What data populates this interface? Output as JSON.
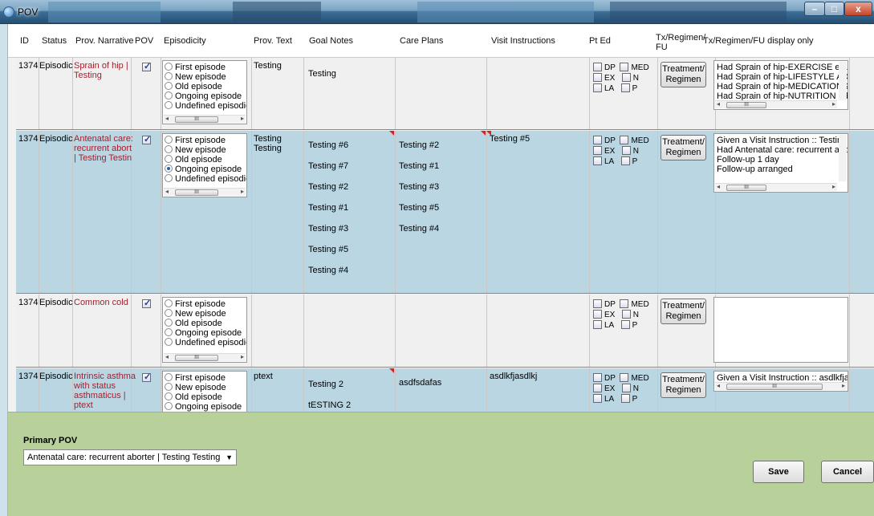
{
  "window": {
    "title": "POV",
    "min_label": "–",
    "max_label": "□",
    "close_label": "x"
  },
  "columns": {
    "id": "ID",
    "status": "Status",
    "narrative": "Prov. Narrative",
    "pov": "POV",
    "episodicity": "Episodicity",
    "prov_text": "Prov. Text",
    "goal_notes": "Goal Notes",
    "care_plans": "Care Plans",
    "visit_instructions": "Visit Instructions",
    "pt_ed": "Pt Ed",
    "tx_line1": "Tx/Regimen/",
    "tx_line2": "FU",
    "tx_display": "Tx/Regimen/FU display only"
  },
  "episode_options": [
    "First episode",
    "New episode",
    "Old episode",
    "Ongoing episode",
    "Undefined episodic"
  ],
  "pt_ed_labels": {
    "dp": "DP",
    "med": "MED",
    "ex": "EX",
    "n": "N",
    "la": "LA",
    "p": "P"
  },
  "tx_button": {
    "line1": "Treatment/",
    "line2": "Regimen"
  },
  "rows": [
    {
      "id": "1374",
      "status": "Episodic",
      "narrative_lines": [
        "Sprain of hip |",
        "Testing"
      ],
      "pov_checked": true,
      "prov_text": [
        "Testing"
      ],
      "goal_notes": [
        "Testing"
      ],
      "care_plans": [],
      "visit_instructions": [],
      "display": [
        "Had Sprain of hip-EXERCISE educ",
        "Had Sprain of hip-LIFESTYLE ADA",
        "Had Sprain of hip-MEDICATIONS",
        "Had Sprain of hip-NUTRITION edu"
      ]
    },
    {
      "id": "1374",
      "status": "Episodic",
      "narrative_lines": [
        "Antenatal care:",
        "recurrent abort",
        "| Testing Testin"
      ],
      "pov_checked": true,
      "episode_selected": "Ongoing episode",
      "prov_text": [
        "Testing",
        "Testing"
      ],
      "goal_notes": [
        "Testing #6",
        "Testing #7",
        "Testing #2",
        "Testing #1",
        "Testing #3",
        "Testing #5",
        "Testing #4"
      ],
      "care_plans": [
        "Testing #2",
        "Testing #1",
        "Testing #3",
        "Testing #5",
        "Testing #4"
      ],
      "visit_instructions": [
        "Testing #5"
      ],
      "display": [
        "Given a Visit Instruction :: Testing",
        "Had Antenatal care: recurrent abc",
        "Follow-up 1 day",
        "Follow-up arranged"
      ]
    },
    {
      "id": "1374",
      "status": "Episodic",
      "narrative_lines": [
        "Common cold"
      ],
      "pov_checked": true,
      "prov_text": [],
      "goal_notes": [],
      "care_plans": [],
      "visit_instructions": [],
      "display": []
    },
    {
      "id": "1374",
      "status": "Episodic",
      "narrative_lines": [
        "Intrinsic asthma",
        "with status",
        "asthmaticus |",
        "ptext"
      ],
      "pov_checked": true,
      "prov_text": [
        "ptext"
      ],
      "goal_notes": [
        "Testing 2",
        "tESTING 2"
      ],
      "care_plans": [
        "asdfsdafas"
      ],
      "visit_instructions": [
        "asdlkfjasdlkj"
      ],
      "display": [
        "Given a Visit Instruction :: asdlkfjasdlk"
      ]
    }
  ],
  "footer": {
    "primary_label": "Primary POV",
    "primary_value": "Antenatal care: recurrent aborter | Testing Testing",
    "save_label": "Save",
    "cancel_label": "Cancel"
  }
}
